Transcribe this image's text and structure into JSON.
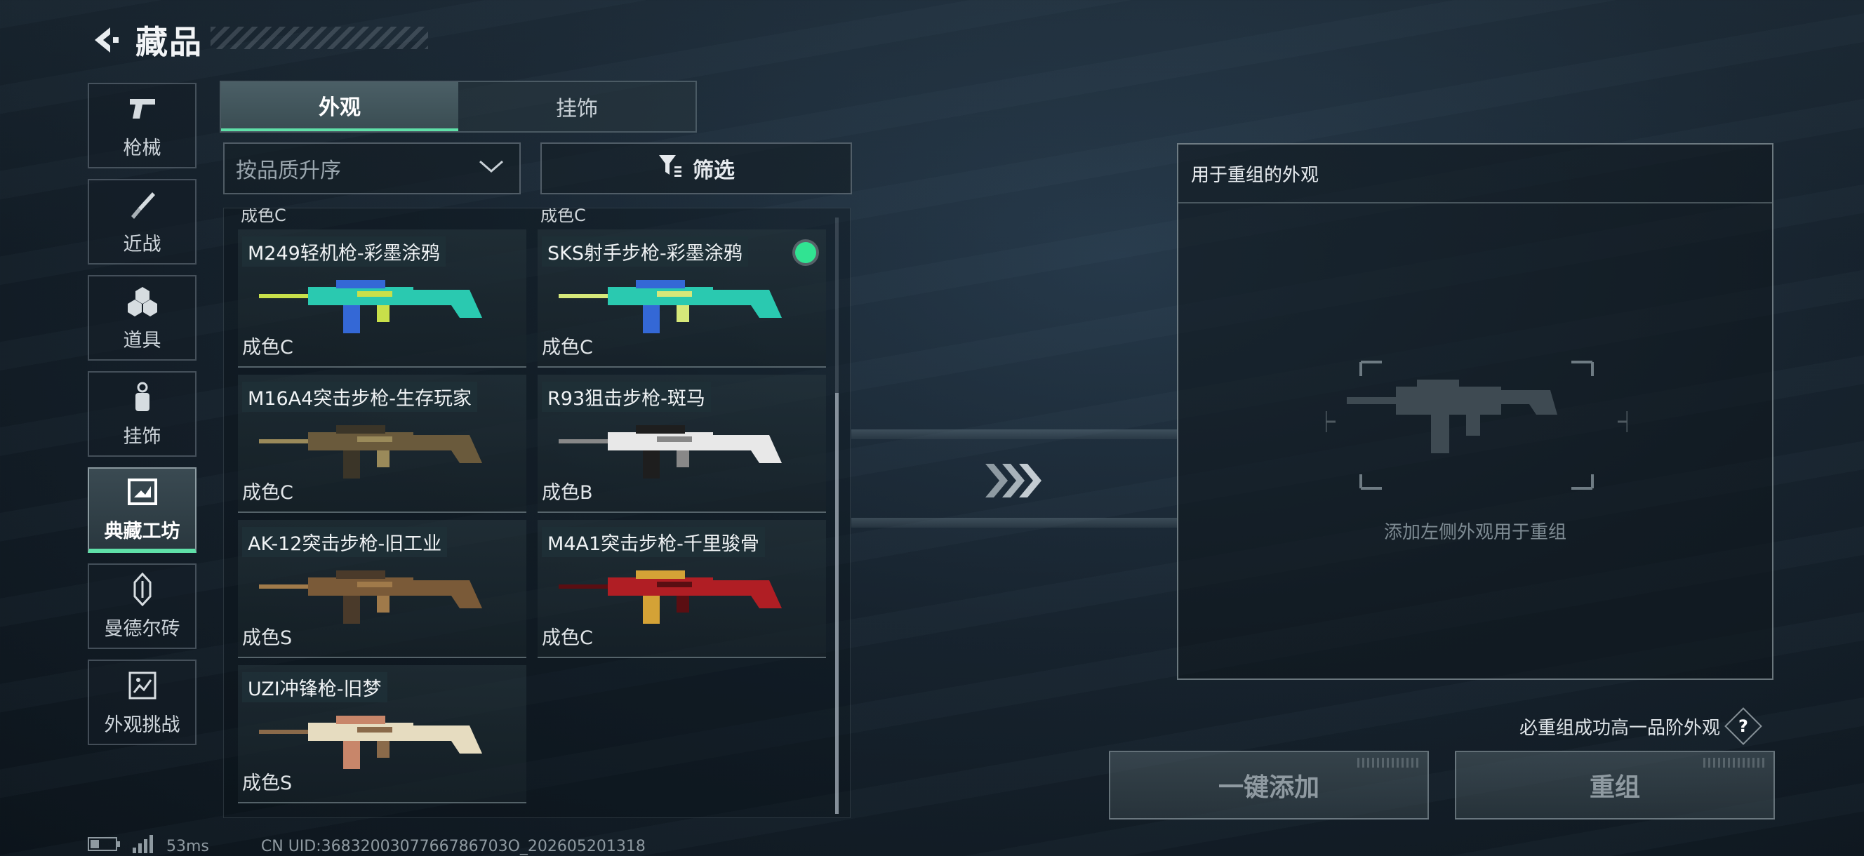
{
  "header": {
    "title": "藏品"
  },
  "sidenav": {
    "items": [
      {
        "label": "枪械",
        "icon": "pistol-icon",
        "active": false
      },
      {
        "label": "近战",
        "icon": "knife-icon",
        "active": false
      },
      {
        "label": "道具",
        "icon": "hex-cluster-icon",
        "active": false
      },
      {
        "label": "挂饰",
        "icon": "charm-icon",
        "active": false
      },
      {
        "label": "典藏工坊",
        "icon": "workshop-icon",
        "active": true
      },
      {
        "label": "曼德尔砖",
        "icon": "mandel-brick-icon",
        "active": false
      },
      {
        "label": "外观挑战",
        "icon": "challenge-icon",
        "active": false
      }
    ]
  },
  "tabs": [
    {
      "label": "外观",
      "active": true
    },
    {
      "label": "挂饰",
      "active": false
    }
  ],
  "sort": {
    "label": "按品质升序"
  },
  "filter": {
    "label": "筛选"
  },
  "grid": {
    "cut_row": [
      "成色C",
      "成色C"
    ],
    "items": [
      {
        "name": "M249轻机枪-彩墨涂鸦",
        "rarity": "成色C",
        "selected": false,
        "palette": [
          "#2ac9b0",
          "#3468d6",
          "#c8e04a"
        ]
      },
      {
        "name": "SKS射手步枪-彩墨涂鸦",
        "rarity": "成色C",
        "selected": true,
        "palette": [
          "#2ac9b0",
          "#3468d6",
          "#d6e87a"
        ]
      },
      {
        "name": "M16A4突击步枪-生存玩家",
        "rarity": "成色C",
        "selected": false,
        "palette": [
          "#6a5a3c",
          "#3b3528",
          "#9a8a5a"
        ]
      },
      {
        "name": "R93狙击步枪-斑马",
        "rarity": "成色B",
        "selected": false,
        "palette": [
          "#e8e8e8",
          "#1e1e1e",
          "#888888"
        ]
      },
      {
        "name": "AK-12突击步枪-旧工业",
        "rarity": "成色S",
        "selected": false,
        "palette": [
          "#7a5a38",
          "#4a3a2a",
          "#a07a4a"
        ]
      },
      {
        "name": "M4A1突击步枪-千里骏骨",
        "rarity": "成色C",
        "selected": false,
        "palette": [
          "#b01e24",
          "#d4a236",
          "#5a0e12"
        ]
      },
      {
        "name": "UZI冲锋枪-旧梦",
        "rarity": "成色S",
        "selected": false,
        "palette": [
          "#e6dcc0",
          "#c8866a",
          "#8a6a4a"
        ]
      }
    ]
  },
  "recombine": {
    "panel_title": "用于重组的外观",
    "placeholder": "添加左侧外观用于重组",
    "guarantee_text": "必重组成功高一品阶外观",
    "help_label": "?",
    "add_all_label": "一键添加",
    "recombine_label": "重组"
  },
  "status": {
    "ping": "53ms",
    "uid": "CN UID:3683200307766786703O_202605201318"
  },
  "colors": {
    "accent": "#5fe0a8",
    "selected_dot": "#31e392"
  }
}
